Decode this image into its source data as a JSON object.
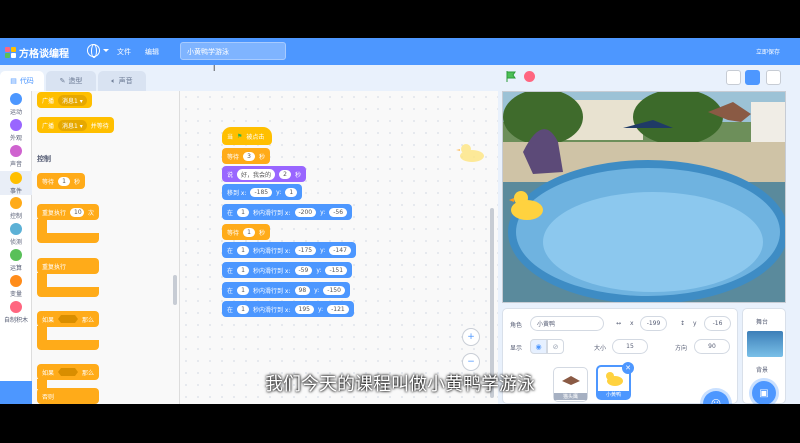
{
  "app": {
    "brand": "方格谈编程",
    "menu_file": "文件",
    "menu_edit": "编辑",
    "project_title": "小黄鸭学游泳",
    "save_now": "立即保存",
    "cursor_mark": "I"
  },
  "tabs": [
    {
      "label": "代码"
    },
    {
      "label": "造型"
    },
    {
      "label": "声音"
    }
  ],
  "categories": [
    {
      "label": "运动",
      "color": "#4c97ff"
    },
    {
      "label": "外观",
      "color": "#9966ff"
    },
    {
      "label": "声音",
      "color": "#cf63cf"
    },
    {
      "label": "事件",
      "color": "#ffbf00"
    },
    {
      "label": "控制",
      "color": "#ffab19"
    },
    {
      "label": "侦测",
      "color": "#5cb1d6"
    },
    {
      "label": "运算",
      "color": "#59c059"
    },
    {
      "label": "变量",
      "color": "#ff8c1a"
    },
    {
      "label": "自制积木",
      "color": "#ff6680"
    }
  ],
  "palette": {
    "broadcast1": "广播",
    "msg1": "消息1 ▾",
    "broadcast2": "广播",
    "msg2": "消息1 ▾",
    "and_wait": "并等待",
    "section_control": "控制",
    "wait": "等待",
    "wait_val": "1",
    "seconds": "秒",
    "repeat": "重复执行",
    "repeat_val": "10",
    "times": "次",
    "forever": "重复执行",
    "if1": "如果",
    "then1": "那么",
    "if2": "如果",
    "then2": "那么",
    "else": "否则"
  },
  "script": {
    "hat_when": "当",
    "hat_clicked": "被点击",
    "wait1_label": "等待",
    "wait1_val": "3",
    "wait1_unit": "秒",
    "say_label": "说",
    "say_text": "好，我会的",
    "say_val": "2",
    "say_unit": "秒",
    "goto_label": "移到 x:",
    "goto_x": "-185",
    "goto_y_label": "y:",
    "goto_y": "1",
    "glide1": {
      "pre": "在",
      "t": "1",
      "mid": "秒内滑行到 x:",
      "x": "-200",
      "y_label": "y:",
      "y": "-56"
    },
    "wait2_label": "等待",
    "wait2_val": "1",
    "wait2_unit": "秒",
    "glide2": {
      "pre": "在",
      "t": "1",
      "mid": "秒内滑行到 x:",
      "x": "-175",
      "y_label": "y:",
      "y": "-147"
    },
    "glide3": {
      "pre": "在",
      "t": "1",
      "mid": "秒内滑行到 x:",
      "x": "-59",
      "y_label": "y:",
      "y": "-151"
    },
    "glide4": {
      "pre": "在",
      "t": "1",
      "mid": "秒内滑行到 x:",
      "x": "98",
      "y_label": "y:",
      "y": "-150"
    },
    "glide5": {
      "pre": "在",
      "t": "1",
      "mid": "秒内滑行到 x:",
      "x": "195",
      "y_label": "y:",
      "y": "-121"
    }
  },
  "zoom": {
    "in": "+",
    "out": "−"
  },
  "sprite_info": {
    "name_label": "角色",
    "name_value": "小黄鸭",
    "x_label": "x",
    "x_value": "-199",
    "y_label": "y",
    "y_value": "-16",
    "show_label": "显示",
    "size_label": "大小",
    "size_value": "15",
    "direction_label": "方向",
    "direction_value": "90"
  },
  "sprites": [
    {
      "label": "猫头鹰"
    },
    {
      "label": "小黄鸭"
    }
  ],
  "stage_panel": {
    "label": "舞台",
    "backdrops_label": "背景"
  },
  "subtitle": "我们今天的课程叫做小黄鸭学游泳",
  "accent": "#4d97ff"
}
